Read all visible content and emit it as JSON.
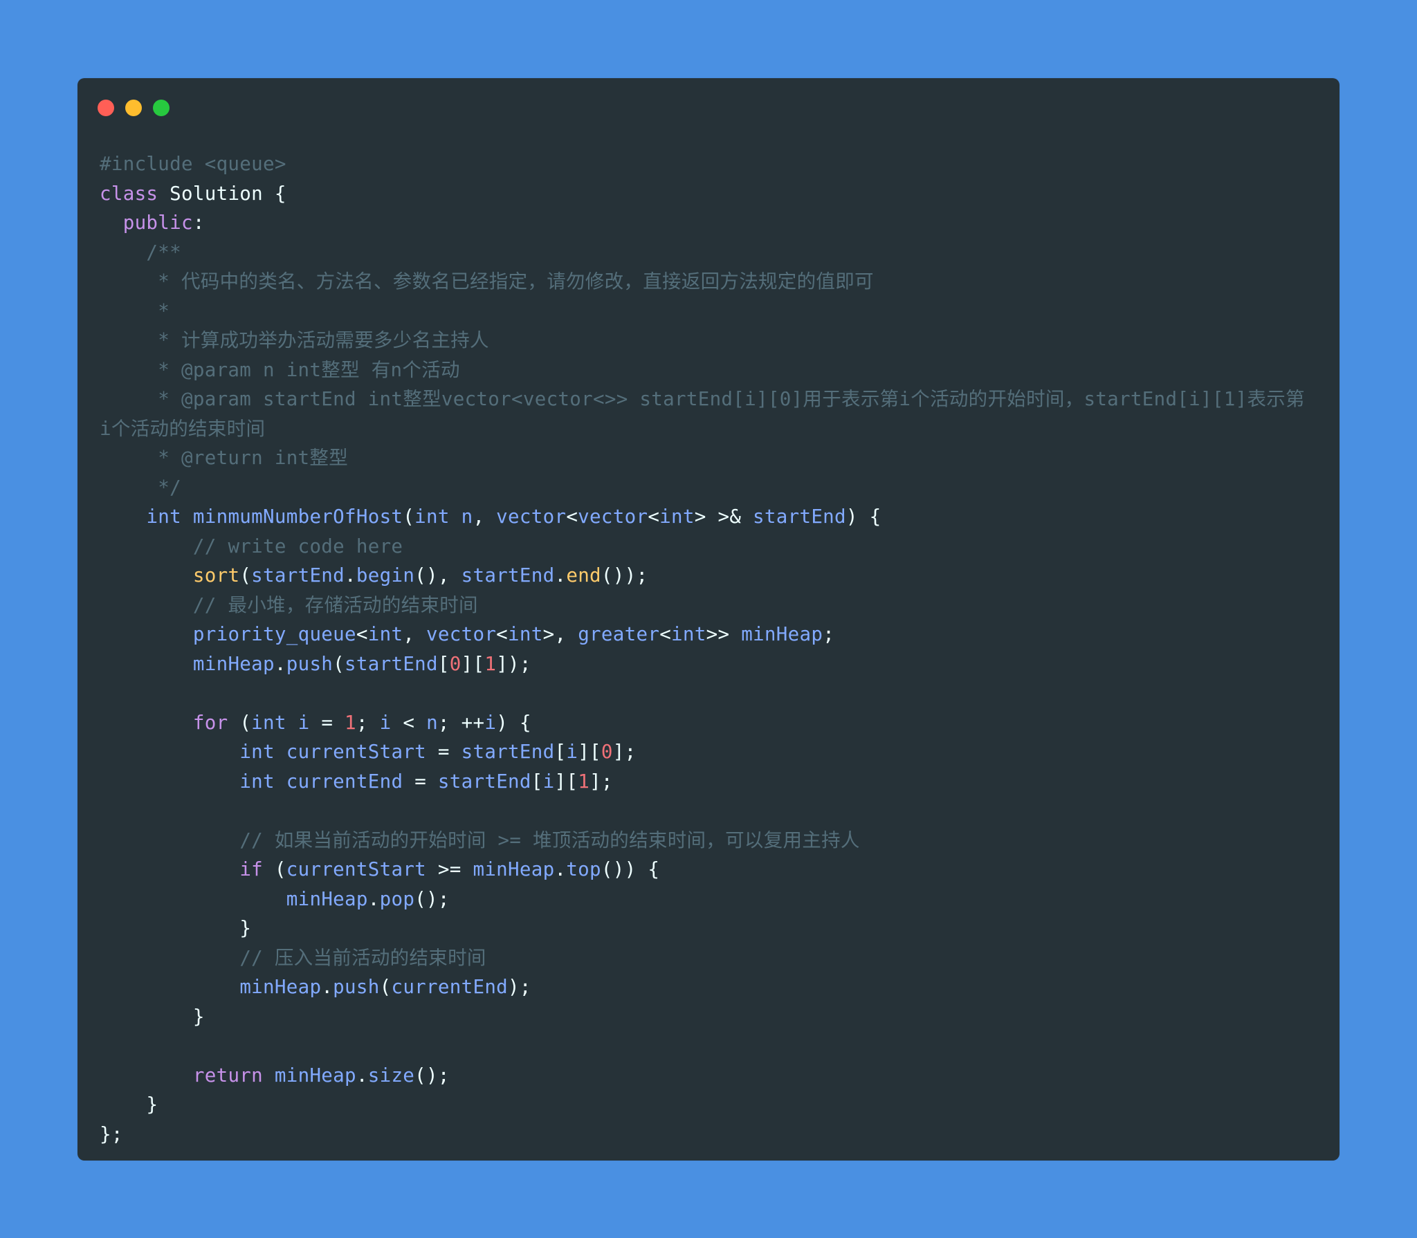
{
  "window": {
    "traffic_lights": {
      "close_color": "#ff5f56",
      "minimize_color": "#ffbd2e",
      "maximize_color": "#27c93f"
    }
  },
  "code": {
    "language": "cpp",
    "lines": [
      "#include <queue>",
      "class Solution {",
      "  public:",
      "    /**",
      "     * 代码中的类名、方法名、参数名已经指定，请勿修改，直接返回方法规定的值即可",
      "     *",
      "     * 计算成功举办活动需要多少名主持人",
      "     * @param n int整型 有n个活动",
      "     * @param startEnd int整型vector<vector<>> startEnd[i][0]用于表示第i个活动的开始时间，startEnd[i][1]表示第",
      "i个活动的结束时间",
      "     * @return int整型",
      "     */",
      "    int minmumNumberOfHost(int n, vector<vector<int> >& startEnd) {",
      "        // write code here",
      "        sort(startEnd.begin(), startEnd.end());",
      "        // 最小堆，存储活动的结束时间",
      "        priority_queue<int, vector<int>, greater<int>> minHeap;",
      "        minHeap.push(startEnd[0][1]);",
      "",
      "        for (int i = 1; i < n; ++i) {",
      "            int currentStart = startEnd[i][0];",
      "            int currentEnd = startEnd[i][1];",
      "",
      "            // 如果当前活动的开始时间 >= 堆顶活动的结束时间，可以复用主持人",
      "            if (currentStart >= minHeap.top()) {",
      "                minHeap.pop();",
      "            }",
      "            // 压入当前活动的结束时间",
      "            minHeap.push(currentEnd);",
      "        }",
      "",
      "        return minHeap.size();",
      "    }",
      "};"
    ]
  },
  "colors": {
    "background": "#4a90e2",
    "editor_bg": "#263238",
    "comment": "#546e7a",
    "keyword": "#c792ea",
    "type": "#82aaff",
    "function": "#ffcb6b",
    "number": "#f07178",
    "text": "#eeffff"
  }
}
